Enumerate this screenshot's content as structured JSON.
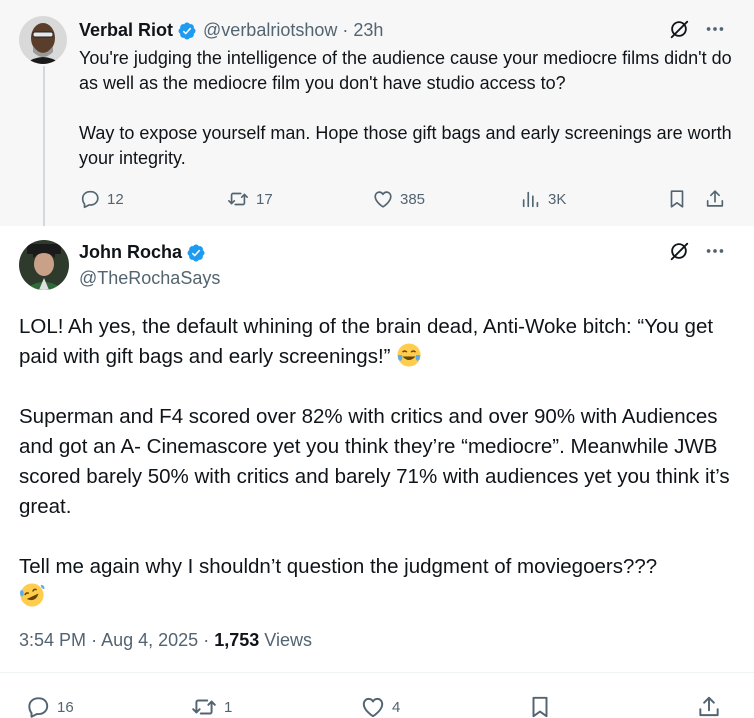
{
  "parent_tweet": {
    "display_name": "Verbal Riot",
    "handle": "@verbalriotshow",
    "separator": "·",
    "time": "23h",
    "paragraphs": [
      "You're judging the intelligence of the audience cause your mediocre films didn't do as well as the mediocre film you don't have studio access to?",
      "Way to expose yourself man. Hope those gift bags and early screenings are worth your integrity."
    ],
    "stats": {
      "replies": "12",
      "reposts": "17",
      "likes": "385",
      "views": "3K"
    }
  },
  "reply_tweet": {
    "display_name": "John Rocha",
    "handle": "@TheRochaSays",
    "paragraph1": "LOL! Ah yes, the default whining of the brain dead, Anti-Woke bitch: “You get paid with gift bags and early screenings!”",
    "paragraph2": "Superman and F4 scored over 82% with critics and over 90% with Audiences and got an A- Cinemascore yet you think they’re “mediocre”. Meanwhile JWB scored barely 50% with critics and barely 71% with audiences yet you think it’s great.",
    "paragraph3": "Tell me again why I shouldn’t question the judgment of moviegoers???",
    "meta": {
      "time": "3:54 PM",
      "date": "Aug 4, 2025",
      "dot": "·",
      "views_count": "1,753",
      "views_label": "Views"
    },
    "stats": {
      "replies": "16",
      "reposts": "1",
      "likes": "4"
    }
  },
  "colors": {
    "verified": "#1d9bf0",
    "muted": "#536471",
    "text": "#0f1419",
    "parent_bg": "#f7f7f7"
  },
  "icons": [
    "verified-badge-icon",
    "grok-icon",
    "more-icon",
    "reply-icon",
    "repost-icon",
    "like-icon",
    "views-icon",
    "bookmark-icon",
    "share-icon"
  ]
}
